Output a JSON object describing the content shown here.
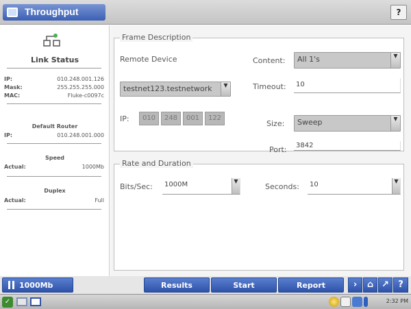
{
  "window": {
    "title": "Throughput",
    "help_label": "?"
  },
  "left_panel": {
    "link_status_label": "Link Status",
    "ip_label": "IP:",
    "ip_value": "010.248.001.126",
    "mask_label": "Mask:",
    "mask_value": "255.255.255.000",
    "mac_label": "MAC:",
    "mac_value": "Fluke-c0097c",
    "default_router_label": "Default Router",
    "router_ip_label": "IP:",
    "router_ip_value": "010.248.001.000",
    "speed_label": "Speed",
    "speed_actual_label": "Actual:",
    "speed_actual_value": "1000Mb",
    "duplex_label": "Duplex",
    "duplex_actual_label": "Actual:",
    "duplex_actual_value": "Full"
  },
  "frame_description": {
    "legend": "Frame Description",
    "remote_device_label": "Remote Device",
    "remote_device_value": "testnet123.testnetwork",
    "ip_label": "IP:",
    "ip_octets": [
      "010",
      "248",
      "001",
      "122"
    ],
    "content_label": "Content:",
    "content_value": "All 1's",
    "timeout_label": "Timeout:",
    "timeout_value": "10",
    "size_label": "Size:",
    "size_value": "Sweep",
    "port_label": "Port:",
    "port_value": "3842"
  },
  "rate_duration": {
    "legend": "Rate and Duration",
    "bits_label": "Bits/Sec:",
    "bits_value": "1000M",
    "seconds_label": "Seconds:",
    "seconds_value": "10"
  },
  "action_bar": {
    "speed_button": "1000Mb",
    "results_button": "Results",
    "start_button": "Start",
    "report_button": "Report"
  },
  "taskbar": {
    "clock": "2:32 PM"
  },
  "colors": {
    "accent": "#2d52a8",
    "title_bar": "#c4c4c4"
  }
}
